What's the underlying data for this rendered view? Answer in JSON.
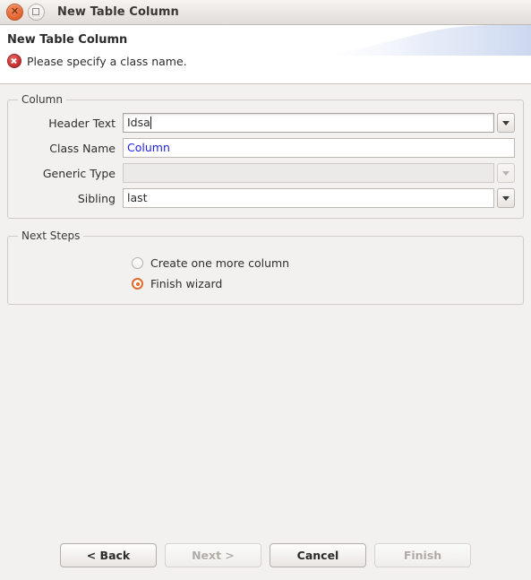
{
  "window": {
    "title": "New Table Column",
    "close_icon": "close-icon",
    "maximize_icon": "maximize-icon"
  },
  "header": {
    "title": "New Table Column",
    "message": "Please specify a class name.",
    "message_icon": "error-icon",
    "message_type": "error"
  },
  "column_group": {
    "legend": "Column",
    "fields": [
      {
        "label": "Header Text",
        "value": "Idsa",
        "placeholder": "",
        "has_dropdown": true,
        "dropdown_icon": "chevron-down-icon",
        "disabled": false,
        "focused": true,
        "value_color": "#2e2e2e"
      },
      {
        "label": "Class Name",
        "value": "Column",
        "placeholder": "",
        "has_dropdown": false,
        "dropdown_icon": "",
        "disabled": false,
        "focused": false,
        "value_color": "#2020ee"
      },
      {
        "label": "Generic Type",
        "value": "",
        "placeholder": "",
        "has_dropdown": true,
        "dropdown_icon": "chevron-down-icon",
        "disabled": true,
        "focused": false,
        "value_color": "#9a958f"
      },
      {
        "label": "Sibling",
        "value": "last",
        "placeholder": "",
        "has_dropdown": true,
        "dropdown_icon": "chevron-down-icon",
        "disabled": false,
        "focused": false,
        "value_color": "#2e2e2e"
      }
    ]
  },
  "next_steps_group": {
    "legend": "Next Steps",
    "options": [
      {
        "label": "Create one more column",
        "selected": false
      },
      {
        "label": "Finish wizard",
        "selected": true
      }
    ]
  },
  "footer": {
    "buttons": [
      {
        "label": "< Back",
        "enabled": true
      },
      {
        "label": "Next >",
        "enabled": false
      },
      {
        "label": "Cancel",
        "enabled": true
      },
      {
        "label": "Finish",
        "enabled": false
      }
    ]
  },
  "colors": {
    "accent_orange": "#e06a2c",
    "error_red": "#cf3b3b",
    "link_blue": "#2020ee",
    "window_bg": "#f2f1f0",
    "header_bg": "#ffffff"
  }
}
